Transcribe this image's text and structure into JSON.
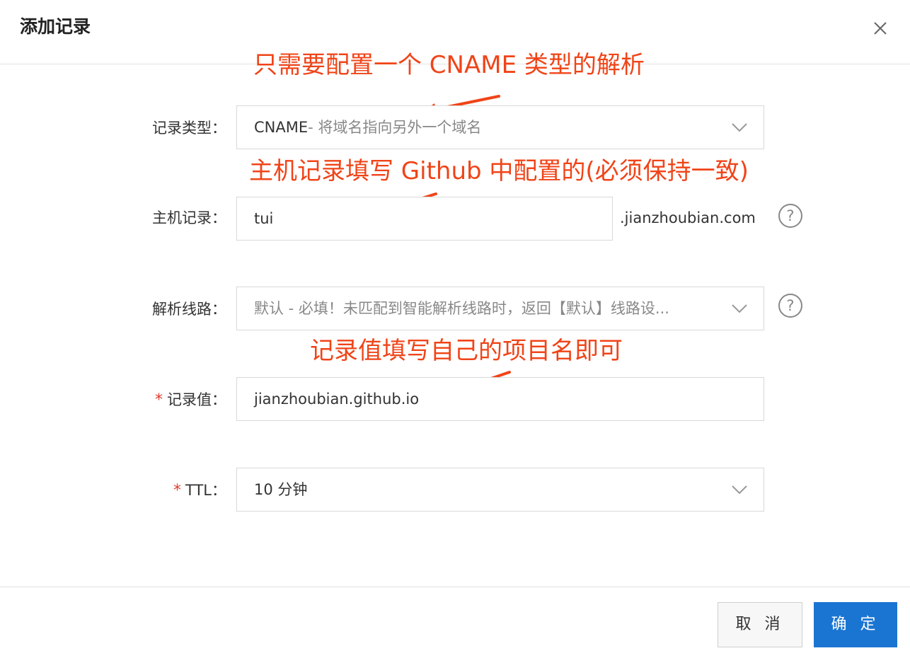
{
  "dialog": {
    "title": "添加记录",
    "close_icon": "close-icon"
  },
  "form": {
    "record_type": {
      "label": "记录类型：",
      "value": "CNAME",
      "hint": "- 将域名指向另外一个域名"
    },
    "host_record": {
      "label": "主机记录：",
      "value": "tui",
      "suffix": ".jianzhoubian.com"
    },
    "resolve_line": {
      "label": "解析线路：",
      "value": "默认 - 必填！未匹配到智能解析线路时，返回【默认】线路设..."
    },
    "record_value": {
      "required_mark": "*",
      "label": "记录值：",
      "value": "jianzhoubian.github.io"
    },
    "ttl": {
      "required_mark": "*",
      "label": "TTL：",
      "value": "10 分钟"
    }
  },
  "annotations": {
    "note1": "只需要配置一个 CNAME 类型的解析",
    "note2": "主机记录填写 Github 中配置的(必须保持一致)",
    "note3": "记录值填写自己的项目名即可"
  },
  "footer": {
    "cancel_label": "取 消",
    "ok_label": "确 定"
  },
  "colors": {
    "annotation": "#f04418",
    "primary": "#1a75d2",
    "required": "#e23a2e"
  }
}
